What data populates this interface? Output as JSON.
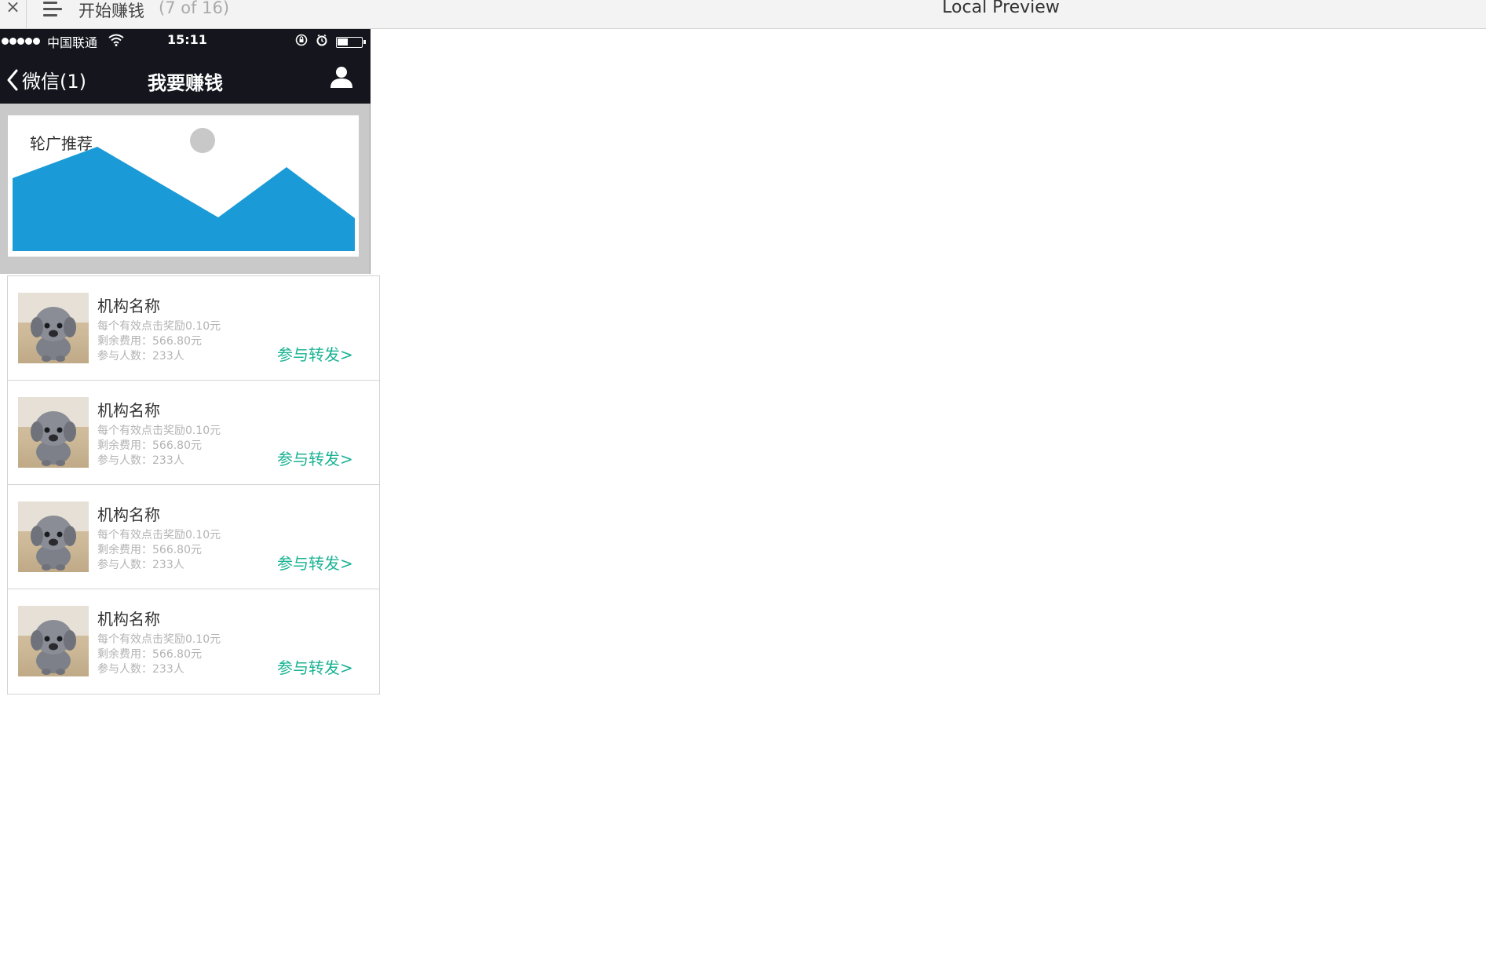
{
  "topbar": {
    "close_glyph": "×",
    "title": "开始赚钱",
    "page_count": "(7 of 16)",
    "center_label": "Local Preview"
  },
  "statusbar": {
    "carrier": "中国联通",
    "time": "15:11"
  },
  "navbar": {
    "back_label": "微信(1)",
    "title": "我要赚钱",
    "user_icon": "user-icon"
  },
  "banner": {
    "label": "轮广推荐",
    "fill_color": "#1a9bd7"
  },
  "colors": {
    "accent": "#1ab394",
    "nav_bg": "#14151d"
  },
  "list": {
    "items": [
      {
        "name": "机构名称",
        "reward": "每个有效点击奖励0.10元",
        "remaining": "剩余费用：566.80元",
        "participants": "参与人数：233人",
        "action": "参与转发>"
      },
      {
        "name": "机构名称",
        "reward": "每个有效点击奖励0.10元",
        "remaining": "剩余费用：566.80元",
        "participants": "参与人数：233人",
        "action": "参与转发>"
      },
      {
        "name": "机构名称",
        "reward": "每个有效点击奖励0.10元",
        "remaining": "剩余费用：566.80元",
        "participants": "参与人数：233人",
        "action": "参与转发>"
      },
      {
        "name": "机构名称",
        "reward": "每个有效点击奖励0.10元",
        "remaining": "剩余费用：566.80元",
        "participants": "参与人数：233人",
        "action": "参与转发>"
      }
    ]
  }
}
